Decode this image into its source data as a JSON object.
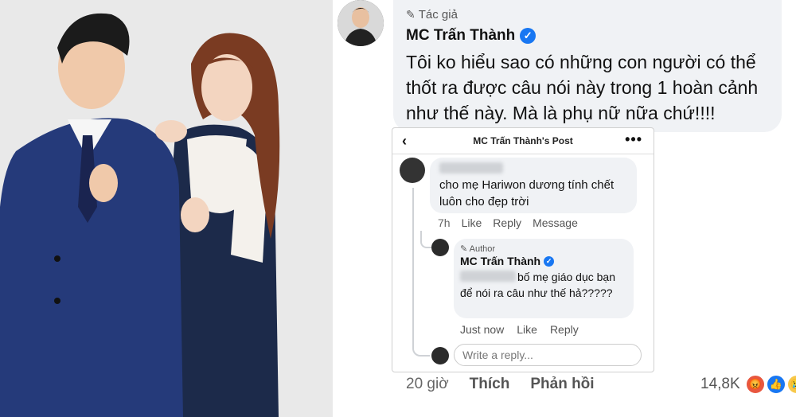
{
  "photo": {
    "alt_icon": "couple-photo"
  },
  "post": {
    "author_badge": "Tác giả",
    "author_name": "MC Trấn Thành",
    "text": "Tôi ko hiểu sao có những con người có thể thốt ra được câu nói này trong 1 hoàn cảnh như thế này. Mà là phụ nữ nữa chứ!!!!"
  },
  "embed": {
    "title": "MC Trấn Thành's Post",
    "comment1": {
      "text": "cho mẹ Hariwon dương tính chết luôn cho đẹp trời",
      "time": "7h",
      "like": "Like",
      "reply": "Reply",
      "message": "Message"
    },
    "comment2": {
      "badge": "Author",
      "name": "MC Trấn Thành",
      "text": "bố mẹ giáo dục bạn để nói ra câu như thế hả?????",
      "time": "Just now",
      "like": "Like",
      "reply": "Reply"
    },
    "reply_placeholder": "Write a reply..."
  },
  "footer": {
    "time": "20 giờ",
    "like": "Thích",
    "reply": "Phản hồi",
    "reaction_count": "14,8K"
  },
  "colors": {
    "verified": "#1877f2",
    "bubble": "#f0f2f5"
  }
}
